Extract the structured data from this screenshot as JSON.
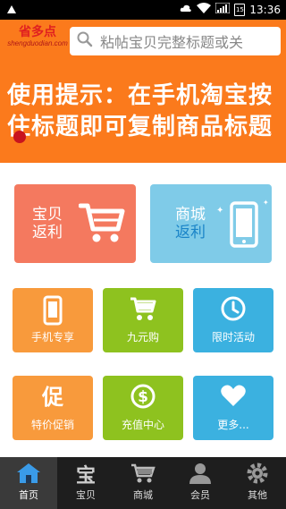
{
  "status_bar": {
    "time": "13:36",
    "battery": "15"
  },
  "header": {
    "logo_cn": "省多点",
    "logo_en": "shengduodian.com",
    "search_placeholder": "粘帖宝贝完整标题或关"
  },
  "banner": {
    "text": "使用提示：在手机淘宝按住标题即可复制商品标题"
  },
  "big_tiles": [
    {
      "line1": "宝贝",
      "line2": "返利",
      "icon": "cart-icon",
      "color": "#f4795f"
    },
    {
      "line1": "商城",
      "line2": "返利",
      "icon": "phone-icon",
      "color": "#7fcbe8"
    }
  ],
  "tiles": [
    {
      "label": "手机专享",
      "icon": "phone-icon",
      "color": "#f89a3c"
    },
    {
      "label": "九元购",
      "icon": "cart-icon",
      "color": "#8ec21f"
    },
    {
      "label": "限时活动",
      "icon": "clock-icon",
      "color": "#3bb1e0"
    },
    {
      "label": "特价促销",
      "icon": "promo-icon",
      "color": "#f89a3c"
    },
    {
      "label": "充值中心",
      "icon": "dollar-icon",
      "color": "#8ec21f"
    },
    {
      "label": "更多...",
      "icon": "heart-icon",
      "color": "#3bb1e0"
    }
  ],
  "tabbar": [
    {
      "label": "首页",
      "icon": "home-icon",
      "active": true
    },
    {
      "label": "宝贝",
      "icon": "bao-icon",
      "active": false
    },
    {
      "label": "商城",
      "icon": "mall-icon",
      "active": false
    },
    {
      "label": "会员",
      "icon": "user-icon",
      "active": false
    },
    {
      "label": "其他",
      "icon": "gear-icon",
      "active": false
    }
  ]
}
